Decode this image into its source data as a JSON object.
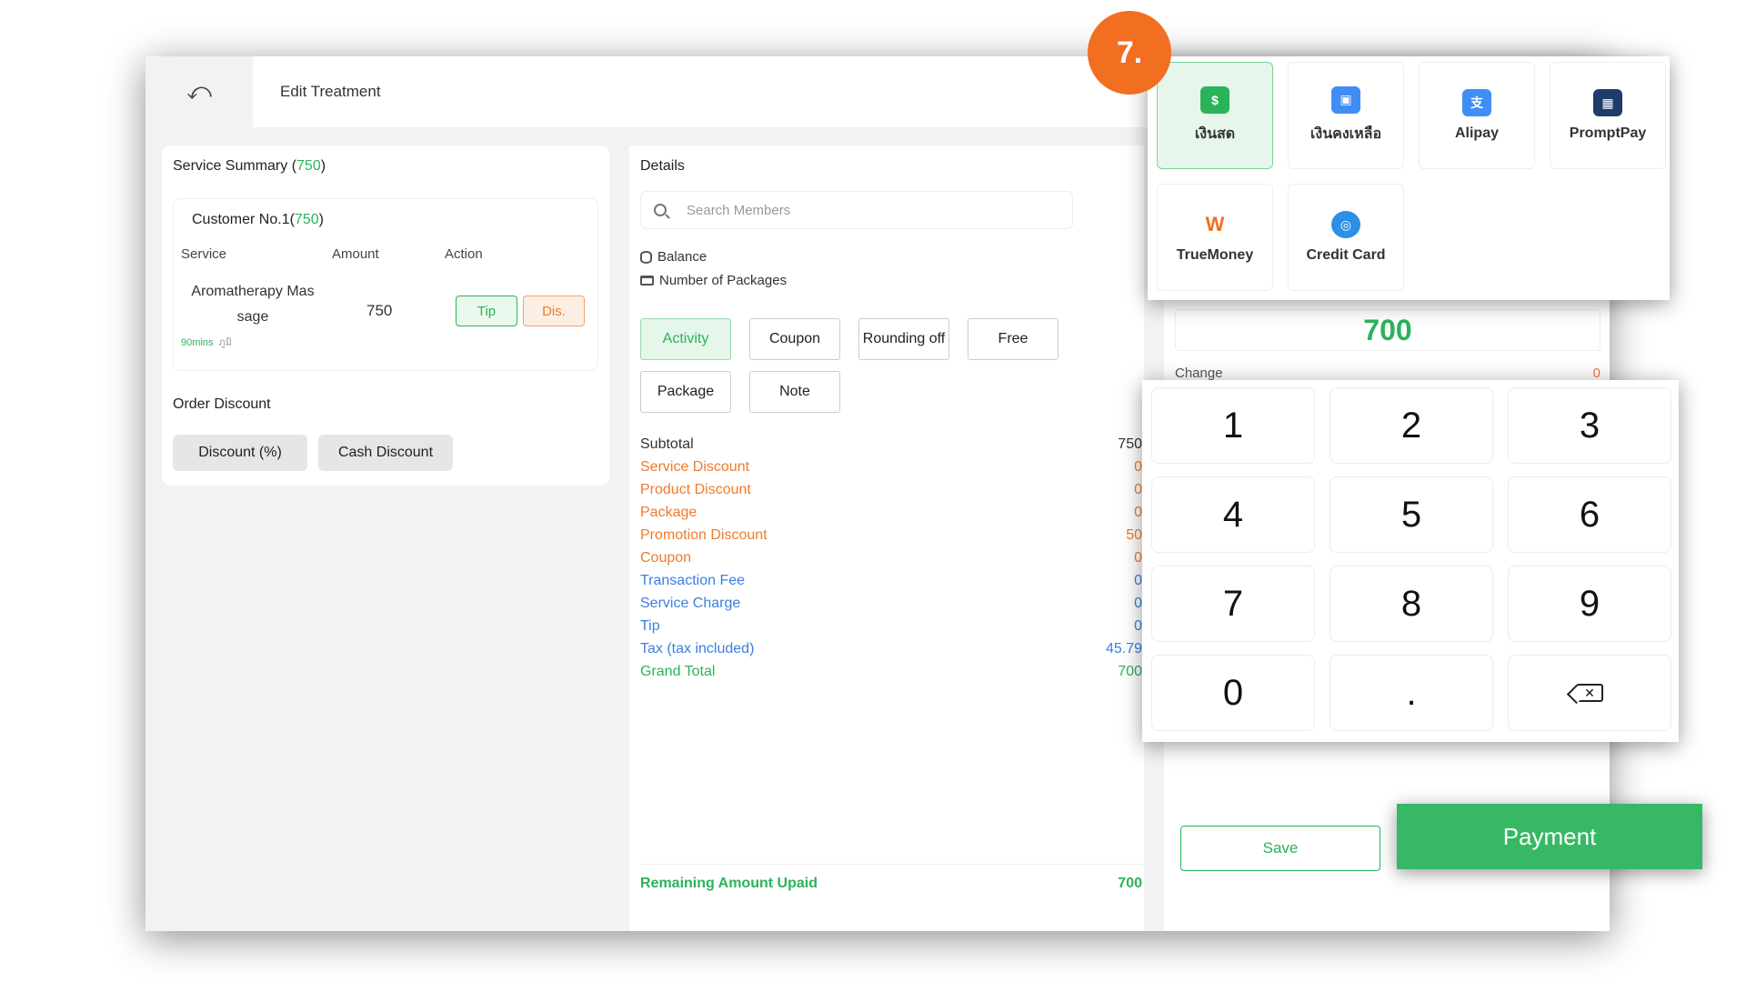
{
  "header": {
    "back_icon": "undo-icon",
    "title": "Edit Treatment"
  },
  "service_summary": {
    "title": "Service Summary",
    "total": "750",
    "customer": {
      "title": "Customer No.1",
      "total": "750",
      "col_service": "Service",
      "col_amount": "Amount",
      "col_action": "Action",
      "service_line1": "Aromatherapy Mas",
      "service_line2": "sage",
      "duration": "90mins",
      "staff": "ภูมิ",
      "amount": "750",
      "tip_label": "Tip",
      "dis_label": "Dis."
    },
    "order_discount": {
      "title": "Order Discount",
      "percent_label": "Discount (%)",
      "cash_label": "Cash Discount"
    }
  },
  "details": {
    "title": "Details",
    "search_placeholder": "Search Members",
    "balance_label": "Balance",
    "packages_label": "Number of Packages",
    "tags": [
      "Activity",
      "Coupon",
      "Rounding off",
      "Free",
      "Package",
      "Note"
    ],
    "summary": [
      {
        "label": "Subtotal",
        "value": "750",
        "color": "dark"
      },
      {
        "label": "Service Discount",
        "value": "0",
        "color": "orange"
      },
      {
        "label": "Product Discount",
        "value": "0",
        "color": "orange"
      },
      {
        "label": "Package",
        "value": "0",
        "color": "orange"
      },
      {
        "label": "Promotion Discount",
        "value": "50",
        "color": "orange"
      },
      {
        "label": "Coupon",
        "value": "0",
        "color": "orange"
      },
      {
        "label": "Transaction Fee",
        "value": "0",
        "color": "blue"
      },
      {
        "label": "Service Charge",
        "value": "0",
        "color": "blue"
      },
      {
        "label": "Tip",
        "value": "0",
        "color": "blue"
      },
      {
        "label": "Tax (tax included)",
        "value": "45.79",
        "color": "blue"
      },
      {
        "label": "Grand Total",
        "value": "700",
        "color": "green"
      }
    ],
    "remaining_label": "Remaining Amount Upaid",
    "remaining_value": "700"
  },
  "payment": {
    "amount": "700",
    "change_label": "Change",
    "change_value": "0",
    "methods": [
      {
        "label": "เงินสด",
        "icon": "cash-icon",
        "color": "#2bb35a"
      },
      {
        "label": "เงินคงเหลือ",
        "icon": "wallet-icon",
        "color": "#3f8ef5"
      },
      {
        "label": "Alipay",
        "icon": "alipay-icon",
        "color": "#3f8ef5"
      },
      {
        "label": "PromptPay",
        "icon": "promptpay-icon",
        "color": "#1d3d6b"
      },
      {
        "label": "TrueMoney",
        "icon": "truemoney-icon",
        "color": "#f26f21"
      },
      {
        "label": "Credit Card",
        "icon": "credit-card-icon",
        "color": "#2d8fe6"
      }
    ],
    "keys": [
      "1",
      "2",
      "3",
      "4",
      "5",
      "6",
      "7",
      "8",
      "9",
      "0",
      ".",
      "⌫"
    ],
    "save_label": "Save",
    "payment_label": "Payment"
  },
  "step_badge": "7.",
  "colors": {
    "accent_green": "#2bb35a",
    "orange": "#f07b2a",
    "blue": "#3b7fe0",
    "badge": "#f26f21"
  }
}
